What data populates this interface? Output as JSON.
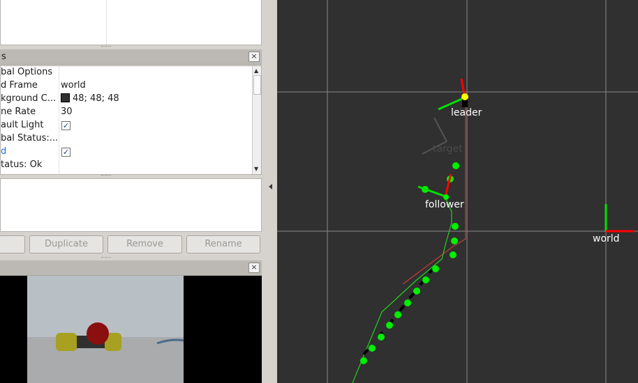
{
  "displays_panel": {
    "title_fragment": "s",
    "close_glyph": "×",
    "rows": [
      {
        "key": "bal Options",
        "value": ""
      },
      {
        "key": "d Frame",
        "value": "world"
      },
      {
        "key": "kground C...",
        "value": "48; 48; 48"
      },
      {
        "key": "ne Rate",
        "value": "30"
      },
      {
        "key": "ault Light",
        "value": ""
      },
      {
        "key": "bal Status:...",
        "value": ""
      },
      {
        "key": "d",
        "value": ""
      },
      {
        "key": "tatus: Ok",
        "value": ""
      }
    ],
    "checkmark": "✓",
    "background_color": "#303030"
  },
  "buttons": {
    "duplicate": "Duplicate",
    "remove": "Remove",
    "rename": "Rename"
  },
  "camera_panel": {
    "close_glyph": "×"
  },
  "viewport": {
    "background": "#303030",
    "labels": {
      "leader": "leader",
      "target": "target",
      "follower": "follower",
      "world": "world"
    },
    "colors": {
      "x_axis": "#ff0000",
      "y_axis": "#00ff00",
      "path": "#00ff00",
      "leader_marker": "#ffff00"
    }
  }
}
